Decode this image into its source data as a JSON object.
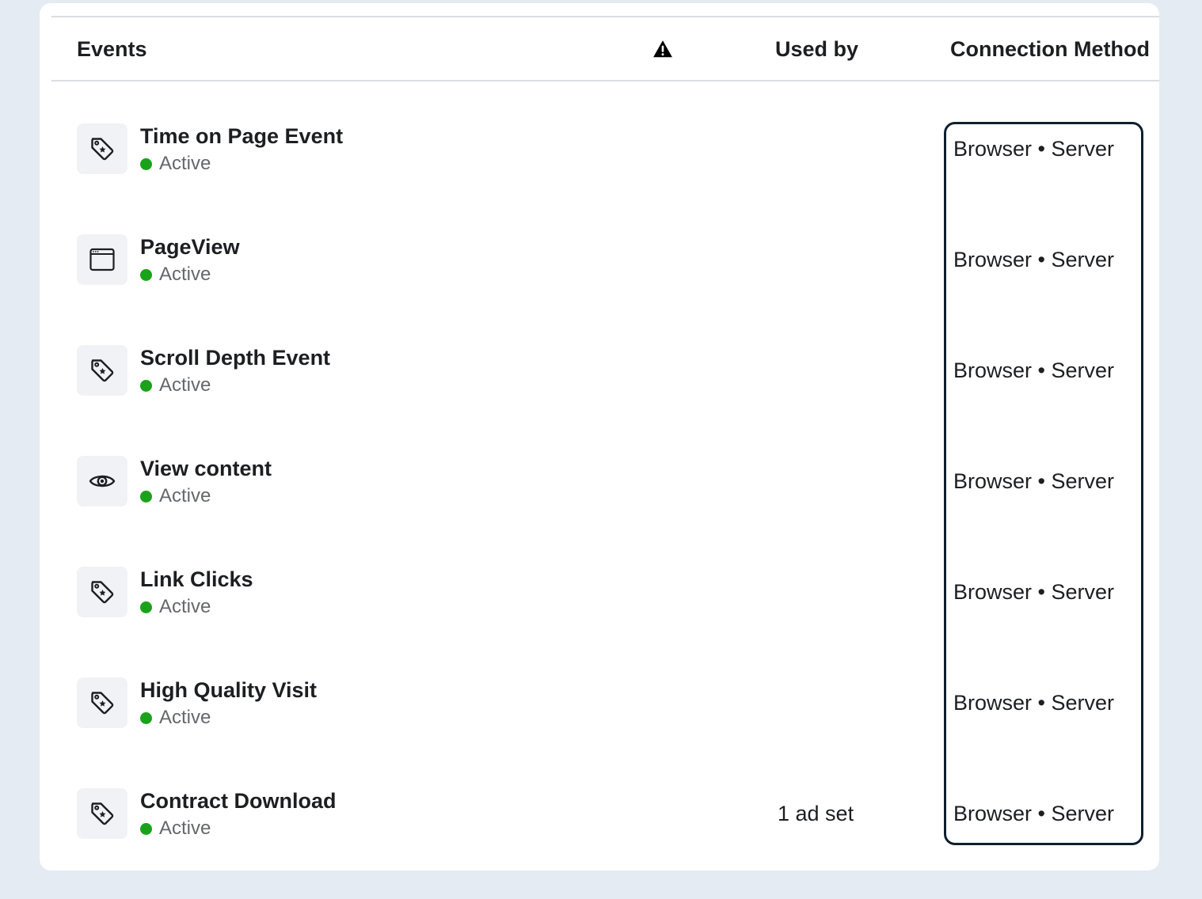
{
  "table": {
    "headers": {
      "events": "Events",
      "warning_icon": "warning-triangle-icon",
      "used_by": "Used by",
      "connection_method": "Connection Method"
    },
    "status_color": "#1aa31a",
    "rows": [
      {
        "name": "Time on Page Event",
        "status": "Active",
        "icon": "tag-icon",
        "used_by": "",
        "method": "Browser • Server"
      },
      {
        "name": "PageView",
        "status": "Active",
        "icon": "browser-window-icon",
        "used_by": "",
        "method": "Browser • Server"
      },
      {
        "name": "Scroll Depth Event",
        "status": "Active",
        "icon": "tag-icon",
        "used_by": "",
        "method": "Browser • Server"
      },
      {
        "name": "View content",
        "status": "Active",
        "icon": "eye-icon",
        "used_by": "",
        "method": "Browser • Server"
      },
      {
        "name": "Link Clicks",
        "status": "Active",
        "icon": "tag-icon",
        "used_by": "",
        "method": "Browser • Server"
      },
      {
        "name": "High Quality Visit",
        "status": "Active",
        "icon": "tag-icon",
        "used_by": "",
        "method": "Browser • Server"
      },
      {
        "name": "Contract Download",
        "status": "Active",
        "icon": "tag-icon",
        "used_by": "1 ad set",
        "method": "Browser • Server"
      }
    ]
  }
}
